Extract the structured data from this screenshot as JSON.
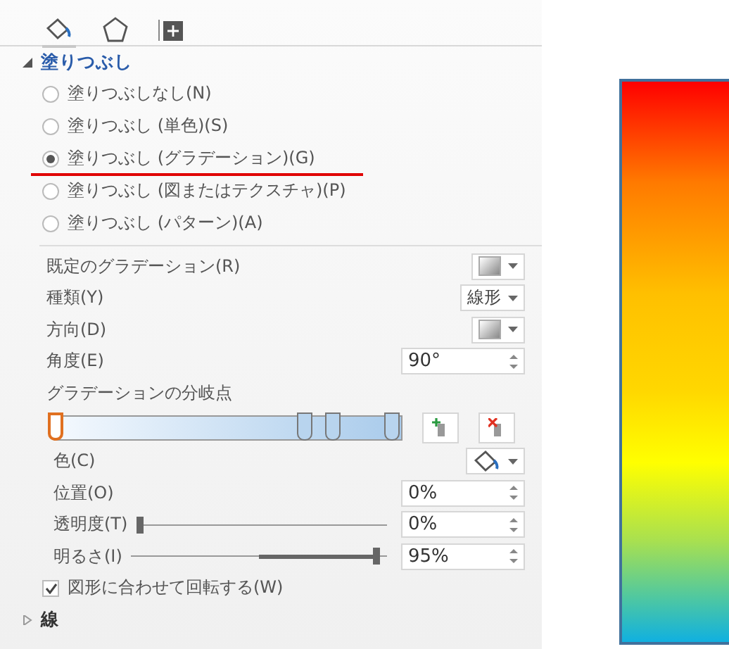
{
  "tabs": [
    {
      "selected": true
    },
    {
      "selected": false
    },
    {
      "selected": false
    }
  ],
  "fill_section": {
    "title": "塗りつぶし",
    "expanded": true,
    "options": [
      {
        "label": "塗りつぶしなし(N)",
        "selected": false
      },
      {
        "label": "塗りつぶし (単色)(S)",
        "selected": false
      },
      {
        "label": "塗りつぶし (グラデーション)(G)",
        "selected": true
      },
      {
        "label": "塗りつぶし (図またはテクスチャ)(P)",
        "selected": false
      },
      {
        "label": "塗りつぶし (パターン)(A)",
        "selected": false
      }
    ],
    "settings": [
      {
        "kind": "dropdown",
        "label": "既定のグラデーション(R)"
      },
      {
        "kind": "dropdown",
        "label": "種類(Y)",
        "value": "線形"
      },
      {
        "kind": "dropdown",
        "label": "方向(D)"
      },
      {
        "kind": "spinner",
        "label": "角度(E)",
        "value": "90°"
      }
    ],
    "stops_label": "グラデーションの分岐点",
    "stops": [
      {
        "level": 0,
        "selected": true
      },
      {
        "level": 0.72,
        "selected": false
      },
      {
        "level": 0.8,
        "selected": false
      },
      {
        "level": 0.97,
        "selected": false
      }
    ],
    "stop_props": [
      {
        "kind": "color",
        "label": "色(C)"
      },
      {
        "kind": "spinner",
        "label": "位置(O)",
        "value": "0%"
      },
      {
        "kind": "slider",
        "label": "透明度(T)",
        "value": "0%",
        "level": 0
      },
      {
        "kind": "slider",
        "label": "明るさ(I)",
        "value": "95%",
        "level": 0.975
      }
    ],
    "rotate_checkbox": {
      "label": "図形に合わせて回転する(W)",
      "checked": true
    }
  },
  "line_section": {
    "title": "線",
    "expanded": false
  }
}
